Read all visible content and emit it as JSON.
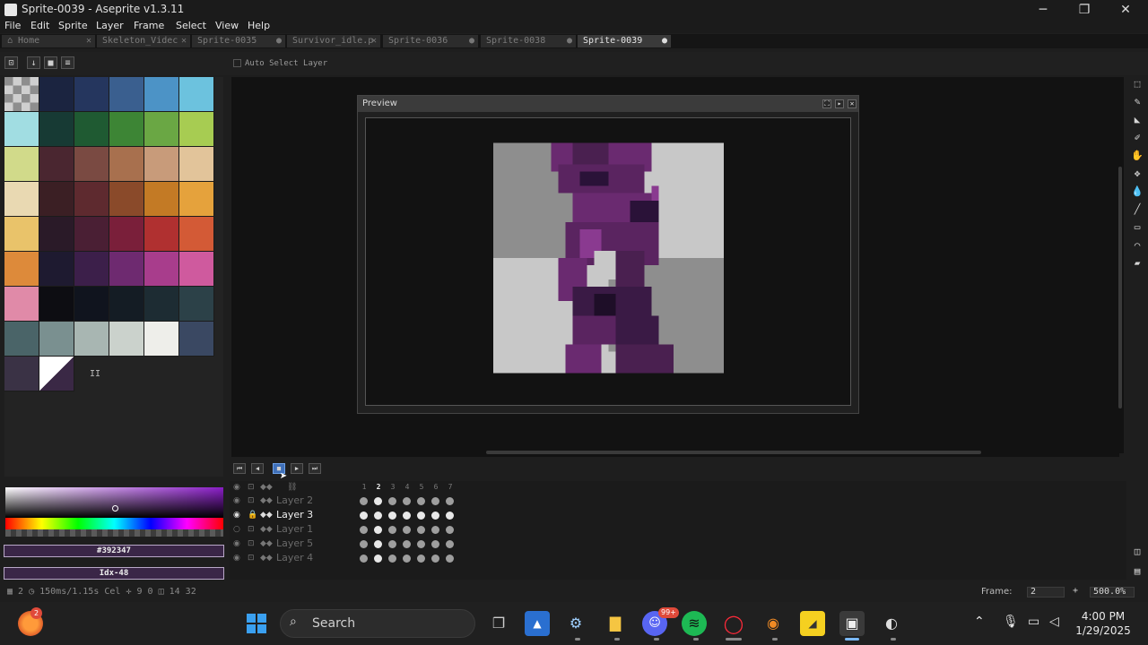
{
  "window": {
    "title": "Sprite-0039 - Aseprite v1.3.11",
    "minimize": "─",
    "maximize": "❐",
    "close": "✕"
  },
  "menu": [
    "File",
    "Edit",
    "Sprite",
    "Layer",
    "Frame",
    "Select",
    "View",
    "Help"
  ],
  "tabs": [
    {
      "label": "⌂ Home",
      "close": "✕"
    },
    {
      "label": "Skeleton_Videc",
      "close": "✕"
    },
    {
      "label": "Sprite-0035",
      "close": "●"
    },
    {
      "label": "Survivor_idle.p",
      "close": "✕"
    },
    {
      "label": "Sprite-0036",
      "close": "●"
    },
    {
      "label": "Sprite-0038",
      "close": "●"
    },
    {
      "label": "Sprite-0039",
      "close": "●"
    }
  ],
  "toolbar": {
    "auto_select_label": "Auto Select Layer",
    "lock_icon": "⊡",
    "download_icon": "↓",
    "save_icon": "■",
    "menu_icon": "≡"
  },
  "palette": {
    "colors": [
      "#000000",
      "#1b2440",
      "#25365e",
      "#3a5f8f",
      "#4c93c6",
      "#6cc2de",
      "#a1dde2",
      "#173a34",
      "#1f5a32",
      "#3d8535",
      "#6aa744",
      "#a7cc52",
      "#d1da8a",
      "#4a2630",
      "#7a4a42",
      "#a8704e",
      "#c89b7a",
      "#e2c49a",
      "#e9d9b2",
      "#3b1f24",
      "#5e2a2f",
      "#8a4a2a",
      "#c37a25",
      "#e5a23c",
      "#e9c36a",
      "#2a1a28",
      "#4a1f34",
      "#7a1f3a",
      "#b03030",
      "#d35a36",
      "#dd8a3a",
      "#1e1a30",
      "#3c1f4a",
      "#6e2a70",
      "#a83d8c",
      "#cf5a9e",
      "#e08aa8",
      "#0d0d12",
      "#10141e",
      "#141c24",
      "#1d2c33",
      "#2c4148",
      "#4a6468",
      "#7a9090",
      "#a8b6b2",
      "#cbd2cc",
      "#eeeeea",
      "#3a4862",
      "#3a3245",
      "#3a2845"
    ],
    "marker": "II"
  },
  "color": {
    "hex": "#392347",
    "index": "Idx-48"
  },
  "preview": {
    "title": "Preview",
    "btn_expand": "⛶",
    "btn_next": "▸",
    "btn_close": "✕"
  },
  "right_tools": [
    "⬚",
    "✎",
    "◣",
    "✐",
    "✋",
    "✥",
    "💧",
    "╱",
    "▭",
    "⌒",
    "▰"
  ],
  "right_bottom": [
    "◫",
    "▤"
  ],
  "playback": [
    "⏮",
    "◀",
    "■",
    "▶",
    "⏭"
  ],
  "cursor": "➤",
  "timeline": {
    "header_icons": [
      "◉",
      "⊡",
      "◆◆",
      "⛓"
    ],
    "frames": [
      "1",
      "2",
      "3",
      "4",
      "5",
      "6",
      "7"
    ],
    "current_frame_index": 1,
    "layers": [
      {
        "name": "Layer 2",
        "eye": "◉",
        "lock": "⊡",
        "cont": "◆◆",
        "active": false,
        "cels": [
          "m",
          "b",
          "m",
          "m",
          "m",
          "m",
          "m"
        ]
      },
      {
        "name": "Layer 3",
        "eye": "◉",
        "lock": "🔒",
        "cont": "◆◆",
        "active": true,
        "cels": [
          "b",
          "b",
          "b",
          "b",
          "b",
          "b",
          "b"
        ]
      },
      {
        "name": "Layer 1",
        "eye": "○",
        "lock": "⊡",
        "cont": "◆◆",
        "active": false,
        "cels": [
          "m",
          "b",
          "m",
          "m",
          "m",
          "m",
          "m"
        ]
      },
      {
        "name": "Layer 5",
        "eye": "◉",
        "lock": "⊡",
        "cont": "◆◆",
        "active": false,
        "cels": [
          "m",
          "b",
          "m",
          "m",
          "m",
          "m",
          "m"
        ]
      },
      {
        "name": "Layer 4",
        "eye": "◉",
        "lock": "⊡",
        "cont": "◆◆",
        "active": false,
        "cels": [
          "m",
          "b",
          "m",
          "m",
          "m",
          "m",
          "m"
        ]
      }
    ]
  },
  "status": {
    "left": "▦ 2  ◷ 150ms/1.15s  Cel  ✛ 9 0  ◫ 14 32",
    "frame_label": "Frame:",
    "frame_value": "2",
    "plus": "+",
    "zoom": "500.0%"
  },
  "taskbar": {
    "search_placeholder": "Search",
    "time": "4:00 PM",
    "date": "1/29/2025",
    "badge": "2",
    "discord_badge": "99+"
  }
}
